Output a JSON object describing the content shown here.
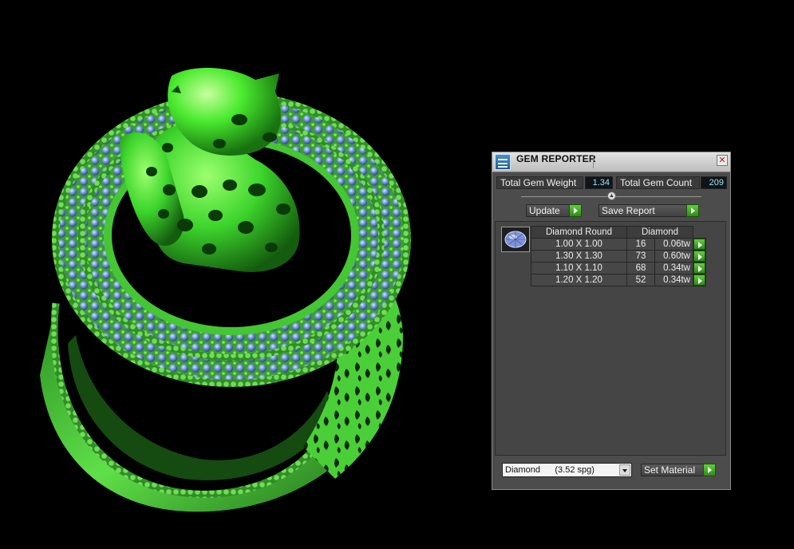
{
  "panel": {
    "title": "GEM REPORTER",
    "close_glyph": "✕",
    "total_weight_label": "Total Gem Weight",
    "total_weight_value": "1.34",
    "total_count_label": "Total Gem Count",
    "total_count_value": "209",
    "update_label": "Update",
    "save_report_label": "Save Report",
    "table": {
      "headers": [
        "Diamond Round",
        "Diamond"
      ],
      "rows": [
        {
          "size": "1.00 X 1.00",
          "count": "16",
          "weight": "0.06tw"
        },
        {
          "size": "1.30 X 1.30",
          "count": "73",
          "weight": "0.60tw"
        },
        {
          "size": "1.10 X 1.10",
          "count": "68",
          "weight": "0.34tw"
        },
        {
          "size": "1.20 X 1.20",
          "count": "52",
          "weight": "0.34tw"
        }
      ]
    },
    "material_select": "Diamond      (3.52 spg)",
    "set_material_label": "Set Material"
  },
  "colors": {
    "ring_green": "#4fe03c",
    "gem_blue": "#6a8fd0",
    "panel_bg": "#4c4c4c",
    "go_button": "#3fae22"
  },
  "icons": {
    "app_icon": "gem-reporter-app-icon",
    "gem_thumbnail": "round-diamond-icon"
  }
}
